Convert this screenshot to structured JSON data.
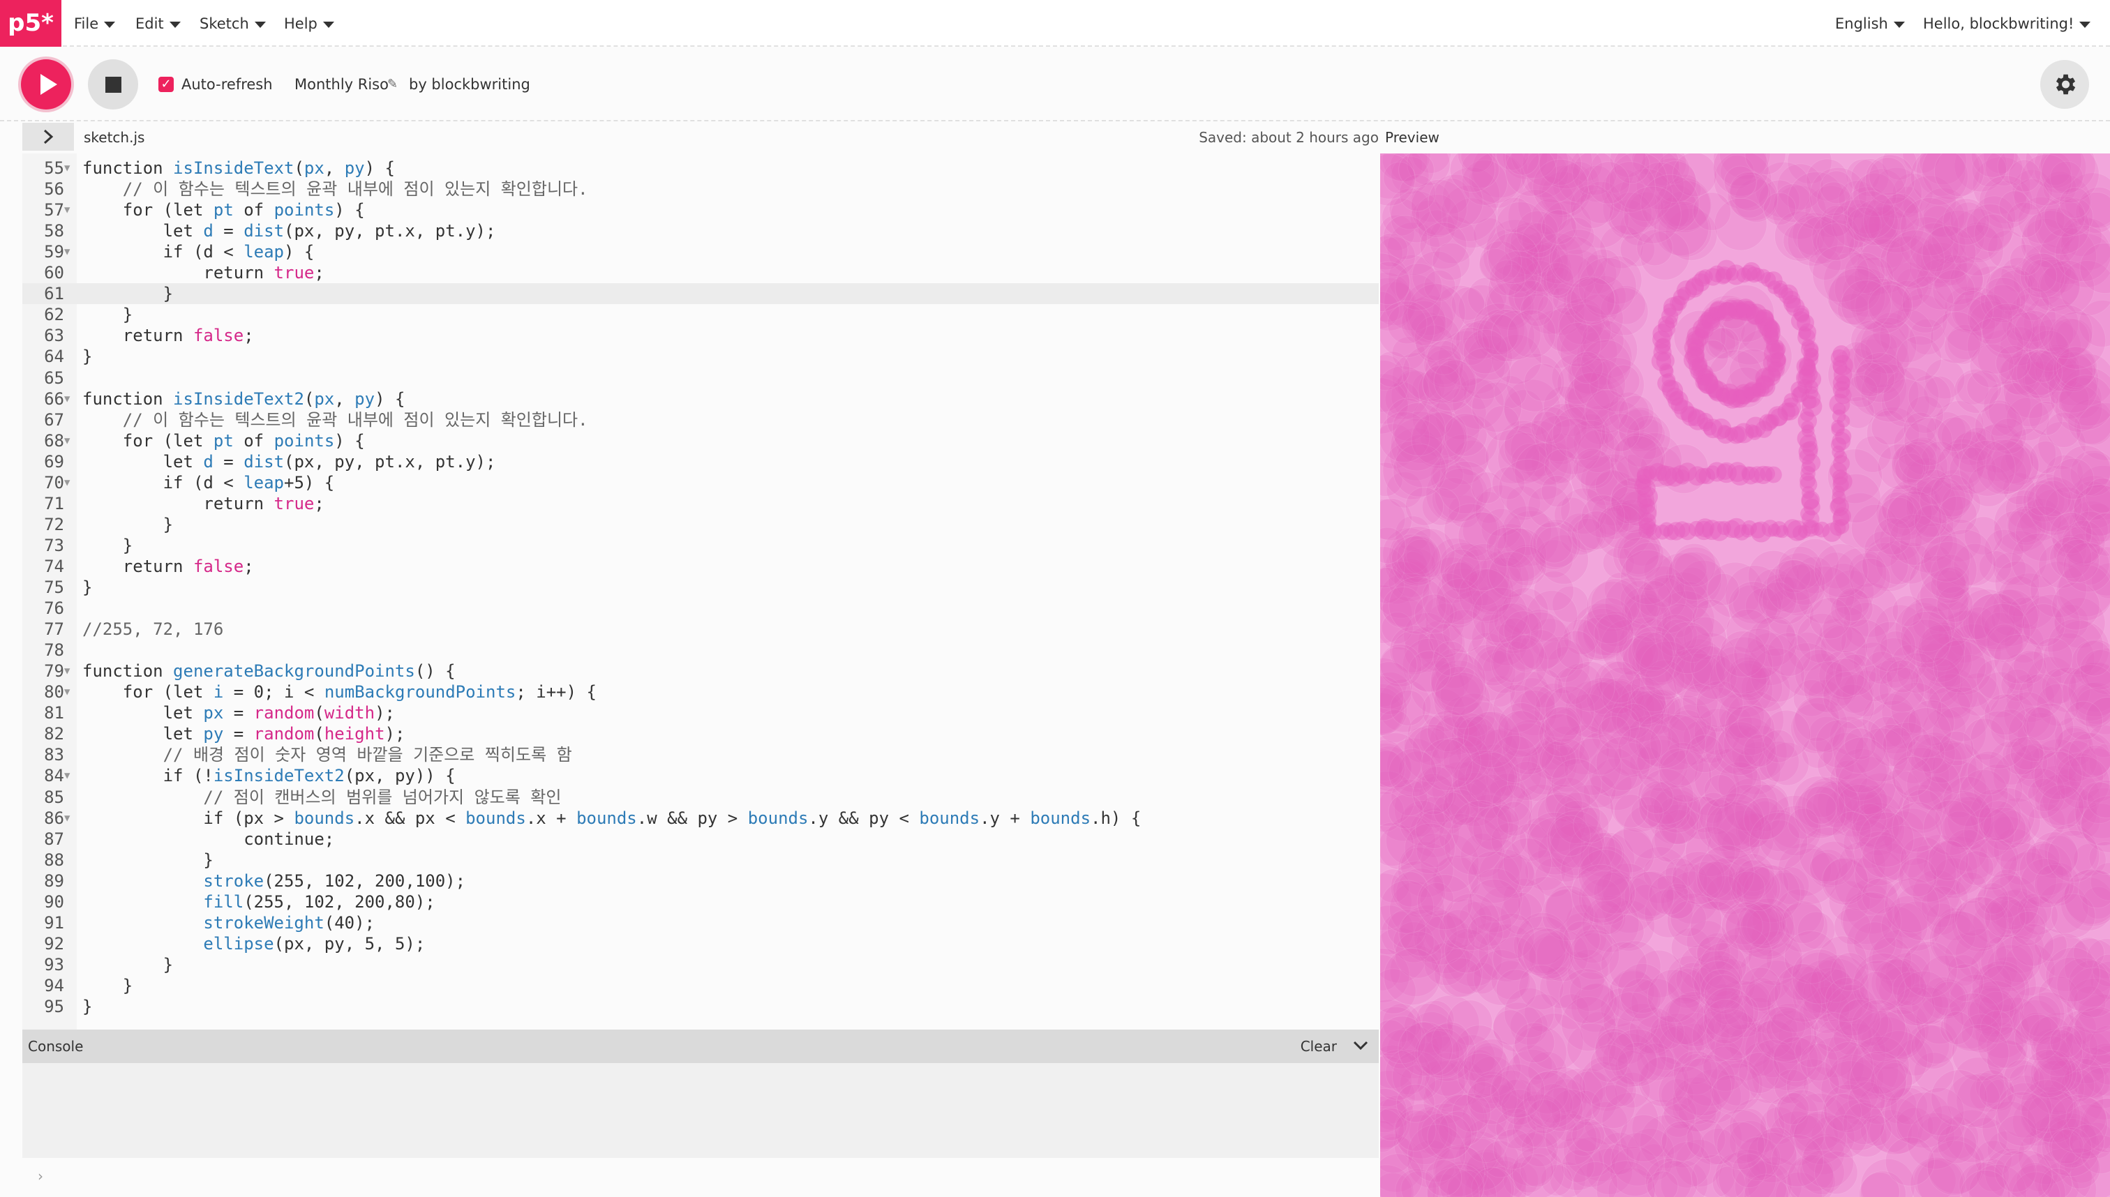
{
  "app": {
    "logo": "p5*"
  },
  "menu": {
    "file": "File",
    "edit": "Edit",
    "sketch": "Sketch",
    "help": "Help",
    "language": "English",
    "user": "Hello, blockbwriting!"
  },
  "toolbar": {
    "auto_refresh_label": "Auto-refresh",
    "auto_refresh_checked": true,
    "sketch_name": "Monthly Riso",
    "author": "by blockbwriting"
  },
  "editor": {
    "file_name": "sketch.js",
    "saved_status": "Saved: about 2 hours ago",
    "highlighted_line": 61,
    "lines": [
      {
        "n": "55",
        "fold": true,
        "html": "<span class='kw'>function</span> <span class='fn'>isInsideText</span>(<span class='var'>px</span>, <span class='var'>py</span>) {"
      },
      {
        "n": "56",
        "fold": false,
        "html": "    <span class='cm'>// 이 함수는 텍스트의 윤곽 내부에 점이 있는지 확인합니다.</span>"
      },
      {
        "n": "57",
        "fold": true,
        "html": "    <span class='kw'>for</span> (<span class='kw'>let</span> <span class='var'>pt</span> <span class='kw'>of</span> <span class='var'>points</span>) {"
      },
      {
        "n": "58",
        "fold": false,
        "html": "        <span class='kw'>let</span> <span class='var'>d</span> = <span class='fn'>dist</span>(px, py, pt.x, pt.y);"
      },
      {
        "n": "59",
        "fold": true,
        "html": "        <span class='kw'>if</span> (d &lt; <span class='var'>leap</span>) {"
      },
      {
        "n": "60",
        "fold": false,
        "html": "            <span class='kw'>return</span> <span class='str'>true</span>;"
      },
      {
        "n": "61",
        "fold": false,
        "html": "        }"
      },
      {
        "n": "62",
        "fold": false,
        "html": "    }"
      },
      {
        "n": "63",
        "fold": false,
        "html": "    <span class='kw'>return</span> <span class='str'>false</span>;"
      },
      {
        "n": "64",
        "fold": false,
        "html": "}"
      },
      {
        "n": "65",
        "fold": false,
        "html": ""
      },
      {
        "n": "66",
        "fold": true,
        "html": "<span class='kw'>function</span> <span class='fn'>isInsideText2</span>(<span class='var'>px</span>, <span class='var'>py</span>) {"
      },
      {
        "n": "67",
        "fold": false,
        "html": "    <span class='cm'>// 이 함수는 텍스트의 윤곽 내부에 점이 있는지 확인합니다.</span>"
      },
      {
        "n": "68",
        "fold": true,
        "html": "    <span class='kw'>for</span> (<span class='kw'>let</span> <span class='var'>pt</span> <span class='kw'>of</span> <span class='var'>points</span>) {"
      },
      {
        "n": "69",
        "fold": false,
        "html": "        <span class='kw'>let</span> <span class='var'>d</span> = <span class='fn'>dist</span>(px, py, pt.x, pt.y);"
      },
      {
        "n": "70",
        "fold": true,
        "html": "        <span class='kw'>if</span> (d &lt; <span class='var'>leap</span>+5) {"
      },
      {
        "n": "71",
        "fold": false,
        "html": "            <span class='kw'>return</span> <span class='str'>true</span>;"
      },
      {
        "n": "72",
        "fold": false,
        "html": "        }"
      },
      {
        "n": "73",
        "fold": false,
        "html": "    }"
      },
      {
        "n": "74",
        "fold": false,
        "html": "    <span class='kw'>return</span> <span class='str'>false</span>;"
      },
      {
        "n": "75",
        "fold": false,
        "html": "}"
      },
      {
        "n": "76",
        "fold": false,
        "html": ""
      },
      {
        "n": "77",
        "fold": false,
        "html": "<span class='cm'>//255, 72, 176</span>"
      },
      {
        "n": "78",
        "fold": false,
        "html": ""
      },
      {
        "n": "79",
        "fold": true,
        "html": "<span class='kw'>function</span> <span class='fn'>generateBackgroundPoints</span>() {"
      },
      {
        "n": "80",
        "fold": true,
        "html": "    <span class='kw'>for</span> (<span class='kw'>let</span> <span class='var'>i</span> = 0; i &lt; <span class='var'>numBackgroundPoints</span>; i++) {"
      },
      {
        "n": "81",
        "fold": false,
        "html": "        <span class='kw'>let</span> <span class='var'>px</span> = <span class='str'>random</span>(<span class='str'>width</span>);"
      },
      {
        "n": "82",
        "fold": false,
        "html": "        <span class='kw'>let</span> <span class='var'>py</span> = <span class='str'>random</span>(<span class='str'>height</span>);"
      },
      {
        "n": "83",
        "fold": false,
        "html": "        <span class='cm'>// 배경 점이 숫자 영역 바깥을 기준으로 찍히도록 함</span>"
      },
      {
        "n": "84",
        "fold": true,
        "html": "        <span class='kw'>if</span> (!<span class='fn'>isInsideText2</span>(px, py)) {"
      },
      {
        "n": "85",
        "fold": false,
        "html": "            <span class='cm'>// 점이 캔버스의 범위를 넘어가지 않도록 확인</span>"
      },
      {
        "n": "86",
        "fold": true,
        "html": "            <span class='kw'>if</span> (px &gt; <span class='var'>bounds</span>.x &amp;&amp; px &lt; <span class='var'>bounds</span>.x + <span class='var'>bounds</span>.w &amp;&amp; py &gt; <span class='var'>bounds</span>.y &amp;&amp; py &lt; <span class='var'>bounds</span>.y + <span class='var'>bounds</span>.h) {"
      },
      {
        "n": "87",
        "fold": false,
        "html": "                <span class='kw'>continue</span>;"
      },
      {
        "n": "88",
        "fold": false,
        "html": "            }"
      },
      {
        "n": "89",
        "fold": false,
        "html": "            <span class='fn'>stroke</span>(255, 102, 200,100);"
      },
      {
        "n": "90",
        "fold": false,
        "html": "            <span class='fn'>fill</span>(255, 102, 200,80);"
      },
      {
        "n": "91",
        "fold": false,
        "html": "            <span class='fn'>strokeWeight</span>(40);"
      },
      {
        "n": "92",
        "fold": false,
        "html": "            <span class='fn'>ellipse</span>(px, py, 5, 5);"
      },
      {
        "n": "93",
        "fold": false,
        "html": "        }"
      },
      {
        "n": "94",
        "fold": false,
        "html": "    }"
      },
      {
        "n": "95",
        "fold": false,
        "html": "}"
      }
    ]
  },
  "console": {
    "title": "Console",
    "clear_label": "Clear",
    "prompt": "›"
  },
  "preview": {
    "label": "Preview",
    "digit": "9",
    "background_color": "#f2a6dc",
    "blob_color": "#e65fbf"
  },
  "colors": {
    "accent": "#ed225d"
  }
}
